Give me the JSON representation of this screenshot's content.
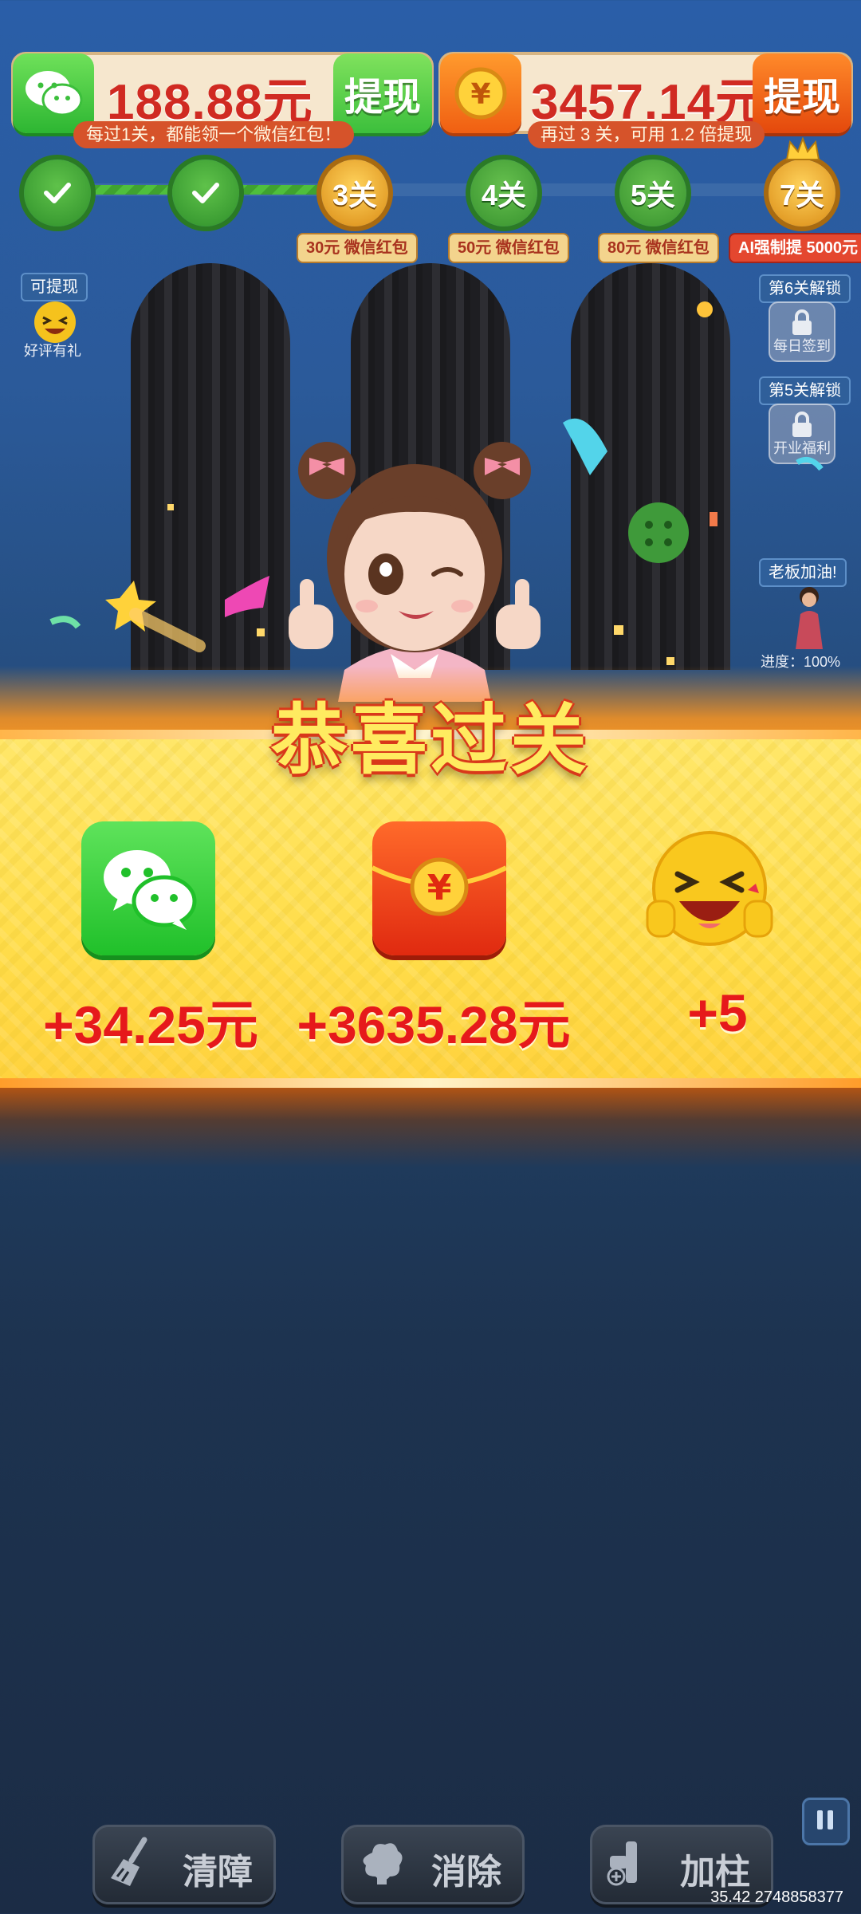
{
  "top_bar": {
    "wechat_balance": "188.88元",
    "wechat_withdraw_label": "提现",
    "wechat_tip": "每过1关，都能领一个微信红包！",
    "yuan_balance": "3457.14元",
    "yuan_withdraw_label": "提现",
    "yuan_tip": "再过 3 关，可用 1.2 倍提现"
  },
  "progress": {
    "nodes": [
      {
        "label": "",
        "status": "done"
      },
      {
        "label": "",
        "status": "done"
      },
      {
        "label": "3关",
        "status": "current"
      },
      {
        "label": "4关",
        "status": "todo"
      },
      {
        "label": "5关",
        "status": "todo"
      },
      {
        "label": "7关",
        "status": "special"
      }
    ],
    "tags": [
      "30元 微信红包",
      "50元 微信红包",
      "80元 微信红包",
      "AI强制提 5000元"
    ]
  },
  "side_left": {
    "withdrawable_label": "可提现",
    "good_review_label": "好评有礼"
  },
  "side_right": {
    "level6_label": "第6关解锁",
    "daily_signin_label": "每日签到",
    "level5_label": "第5关解锁",
    "welfare_label": "开业福利",
    "boss_cheer_label": "老板加油!",
    "progress_label": "进度：100%"
  },
  "banner": {
    "title": "恭喜过关",
    "rewards": [
      {
        "icon": "wechat-icon",
        "value": "+34.25元"
      },
      {
        "icon": "red-envelope-icon",
        "value": "+3635.28元"
      },
      {
        "icon": "laughing-emoji-icon",
        "value": "+5"
      }
    ]
  },
  "tools": {
    "clear_label": "清障",
    "eliminate_label": "消除",
    "add_pillar_label": "加柱"
  },
  "footer": {
    "stat": "35.42 2748858377"
  },
  "colors": {
    "accent_red": "#e6191b",
    "banner_yellow": "#ffdd4a",
    "wechat_green": "#3cbf3c",
    "orange": "#f05f12"
  }
}
